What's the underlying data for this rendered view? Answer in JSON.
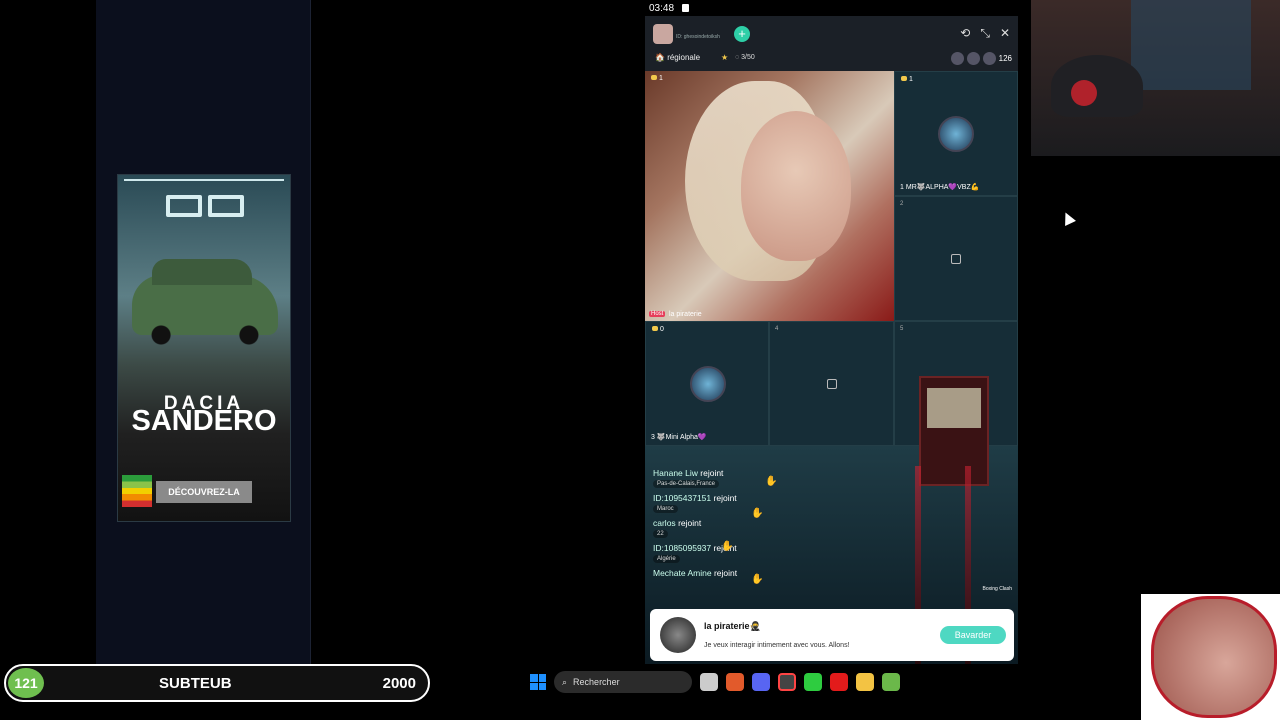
{
  "status_bar": {
    "time": "03:48"
  },
  "ad": {
    "brand": "DACIA",
    "model": "SANDERO",
    "cta": "DÉCOUVREZ-LA"
  },
  "room": {
    "host_id_label": "ID: ghesoindetoiksh",
    "tag": "régionale",
    "seats": "3/50",
    "viewer_count": "126",
    "host_label": "Host",
    "host_name": "la piraterie"
  },
  "tiles": [
    {
      "coins": "1",
      "seat": "1",
      "name": "MR🐺ALPHA💜VBZ💪"
    },
    {
      "seat": "2"
    },
    {
      "coins": "0",
      "seat": "3",
      "name": "🐺Mini Alpha💜"
    },
    {
      "seat": "4"
    },
    {
      "seat": "5"
    }
  ],
  "host_coins": "1",
  "chat": [
    {
      "name": "Hanane Liw",
      "action": "rejoint",
      "sub": "Pas-de-Calais,France"
    },
    {
      "name": "ID:1095437151",
      "action": "rejoint",
      "sub": "Maroc"
    },
    {
      "name": "carlos",
      "action": "rejoint",
      "sub": "22"
    },
    {
      "name": "ID:1085095937",
      "action": "rejoint",
      "sub": "Algérie"
    },
    {
      "name": "Mechate Amine",
      "action": "rejoint",
      "sub": ""
    }
  ],
  "game": {
    "label": "Boxing Clash"
  },
  "card": {
    "name": "la piraterie🥷",
    "message": "Je veux interagir intimement avec vous. Allons!",
    "button": "Bavarder"
  },
  "scorebar": {
    "badge": "121",
    "label": "SUBTEUB",
    "value": "2000"
  },
  "taskbar": {
    "search_placeholder": "Rechercher"
  },
  "colors": {
    "accent": "#2ecfa7",
    "host_badge": "#e63d5a",
    "score_badge": "#6fbf4f"
  }
}
